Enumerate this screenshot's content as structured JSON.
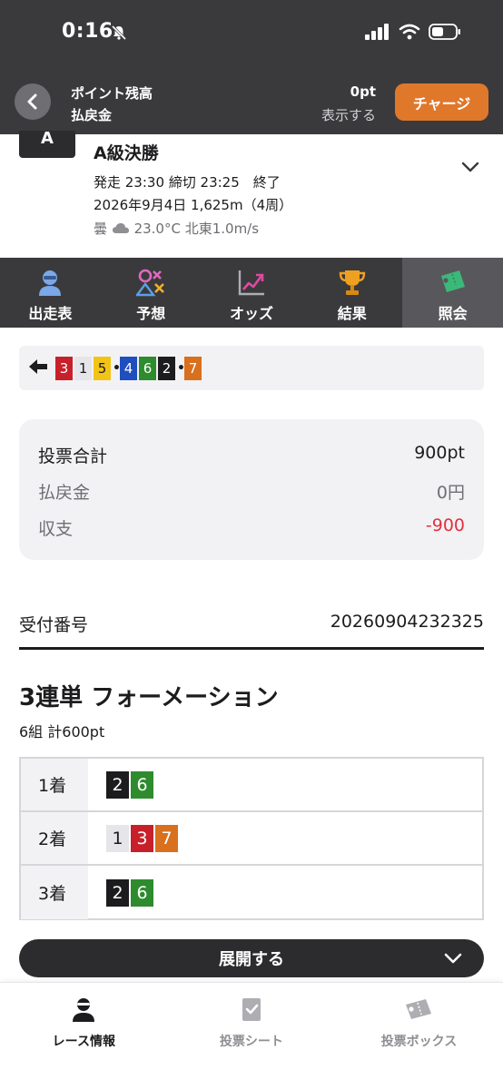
{
  "status_bar": {
    "time": "0:16"
  },
  "header": {
    "points_label": "ポイント残高",
    "refund_label": "払戻金",
    "points_value": "0pt",
    "show_label": "表示する",
    "charge_button": "チャージ"
  },
  "race": {
    "icon_text": "A",
    "title": "A級決勝",
    "line1": "発走 23:30 締切 23:25　終了",
    "line2": "2026年9月4日 1,625m（4周）",
    "weather": "曇",
    "weather_detail": "23.0°C 北東1.0m/s"
  },
  "tabs": [
    {
      "label": "出走表",
      "icon": "racer-icon"
    },
    {
      "label": "予想",
      "icon": "prediction-icon"
    },
    {
      "label": "オッズ",
      "icon": "odds-chart-icon"
    },
    {
      "label": "結果",
      "icon": "trophy-icon"
    },
    {
      "label": "照会",
      "icon": "ticket-icon",
      "active": true
    }
  ],
  "result_order": {
    "items": [
      "3",
      "1",
      "5",
      "•",
      "4",
      "6",
      "2",
      "•",
      "7"
    ]
  },
  "summary": {
    "total_label": "投票合計",
    "total_value": "900pt",
    "refund_label": "払戻金",
    "refund_value": "0円",
    "balance_label": "収支",
    "balance_value": "-900"
  },
  "receipt": {
    "label": "受付番号",
    "number": "20260904232325"
  },
  "bet": {
    "title": "3連単 フォーメーション",
    "subtitle": "6組 計600pt",
    "rows": [
      {
        "label": "1着",
        "numbers": [
          "2",
          "6"
        ]
      },
      {
        "label": "2着",
        "numbers": [
          "1",
          "3",
          "7"
        ]
      },
      {
        "label": "3着",
        "numbers": [
          "2",
          "6"
        ]
      }
    ]
  },
  "expand_button": "展開する",
  "bottom_nav": [
    {
      "label": "レース情報",
      "icon": "race-info-icon",
      "active": true
    },
    {
      "label": "投票シート",
      "icon": "vote-sheet-icon"
    },
    {
      "label": "投票ボックス",
      "icon": "vote-box-icon"
    }
  ],
  "colors": {
    "header_bg": "#3a3a3c",
    "accent_orange": "#e0782c",
    "negative_red": "#e0323e",
    "num_1": "#e5e5ea",
    "num_2": "#1c1c1e",
    "num_3": "#c8202a",
    "num_4": "#1f4fbf",
    "num_5": "#f2c418",
    "num_6": "#2e8b2e",
    "num_7": "#d8701e"
  }
}
